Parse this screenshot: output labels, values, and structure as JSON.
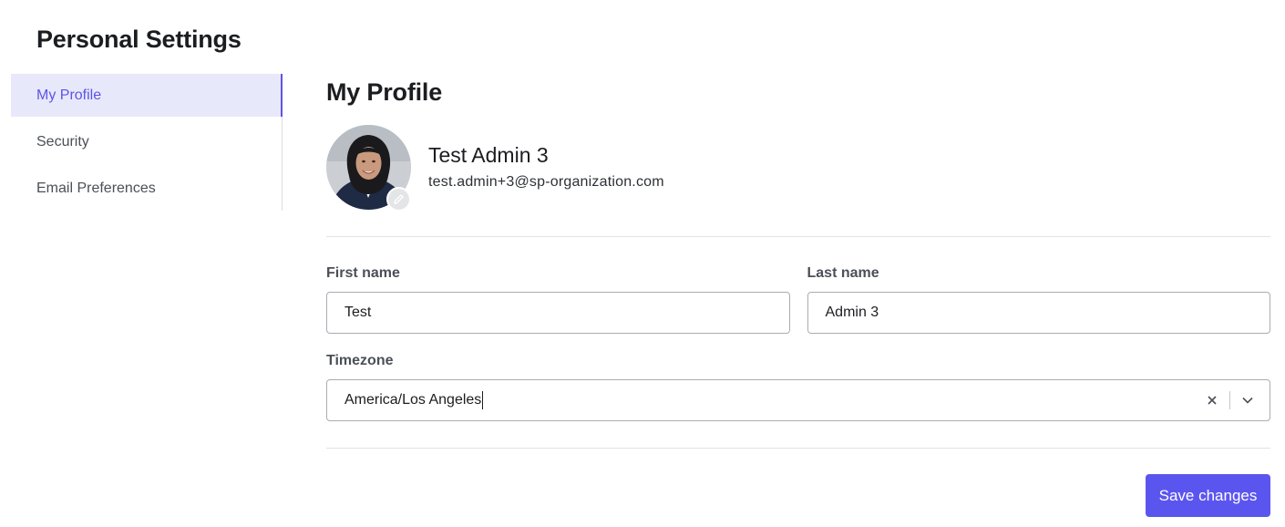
{
  "page": {
    "title": "Personal Settings"
  },
  "sidebar": {
    "items": [
      {
        "label": "My Profile",
        "active": true
      },
      {
        "label": "Security",
        "active": false
      },
      {
        "label": "Email Preferences",
        "active": false
      }
    ]
  },
  "profile": {
    "section_title": "My Profile",
    "name": "Test Admin 3",
    "email": "test.admin+3@sp-organization.com",
    "avatar_icon": "user-photo",
    "edit_icon": "pencil-icon"
  },
  "form": {
    "first_name": {
      "label": "First name",
      "value": "Test"
    },
    "last_name": {
      "label": "Last name",
      "value": "Admin 3"
    },
    "timezone": {
      "label": "Timezone",
      "value": "America/Los Angeles"
    }
  },
  "actions": {
    "save_label": "Save changes"
  },
  "colors": {
    "accent": "#5b55f0",
    "active_bg": "#e8e8fb"
  }
}
